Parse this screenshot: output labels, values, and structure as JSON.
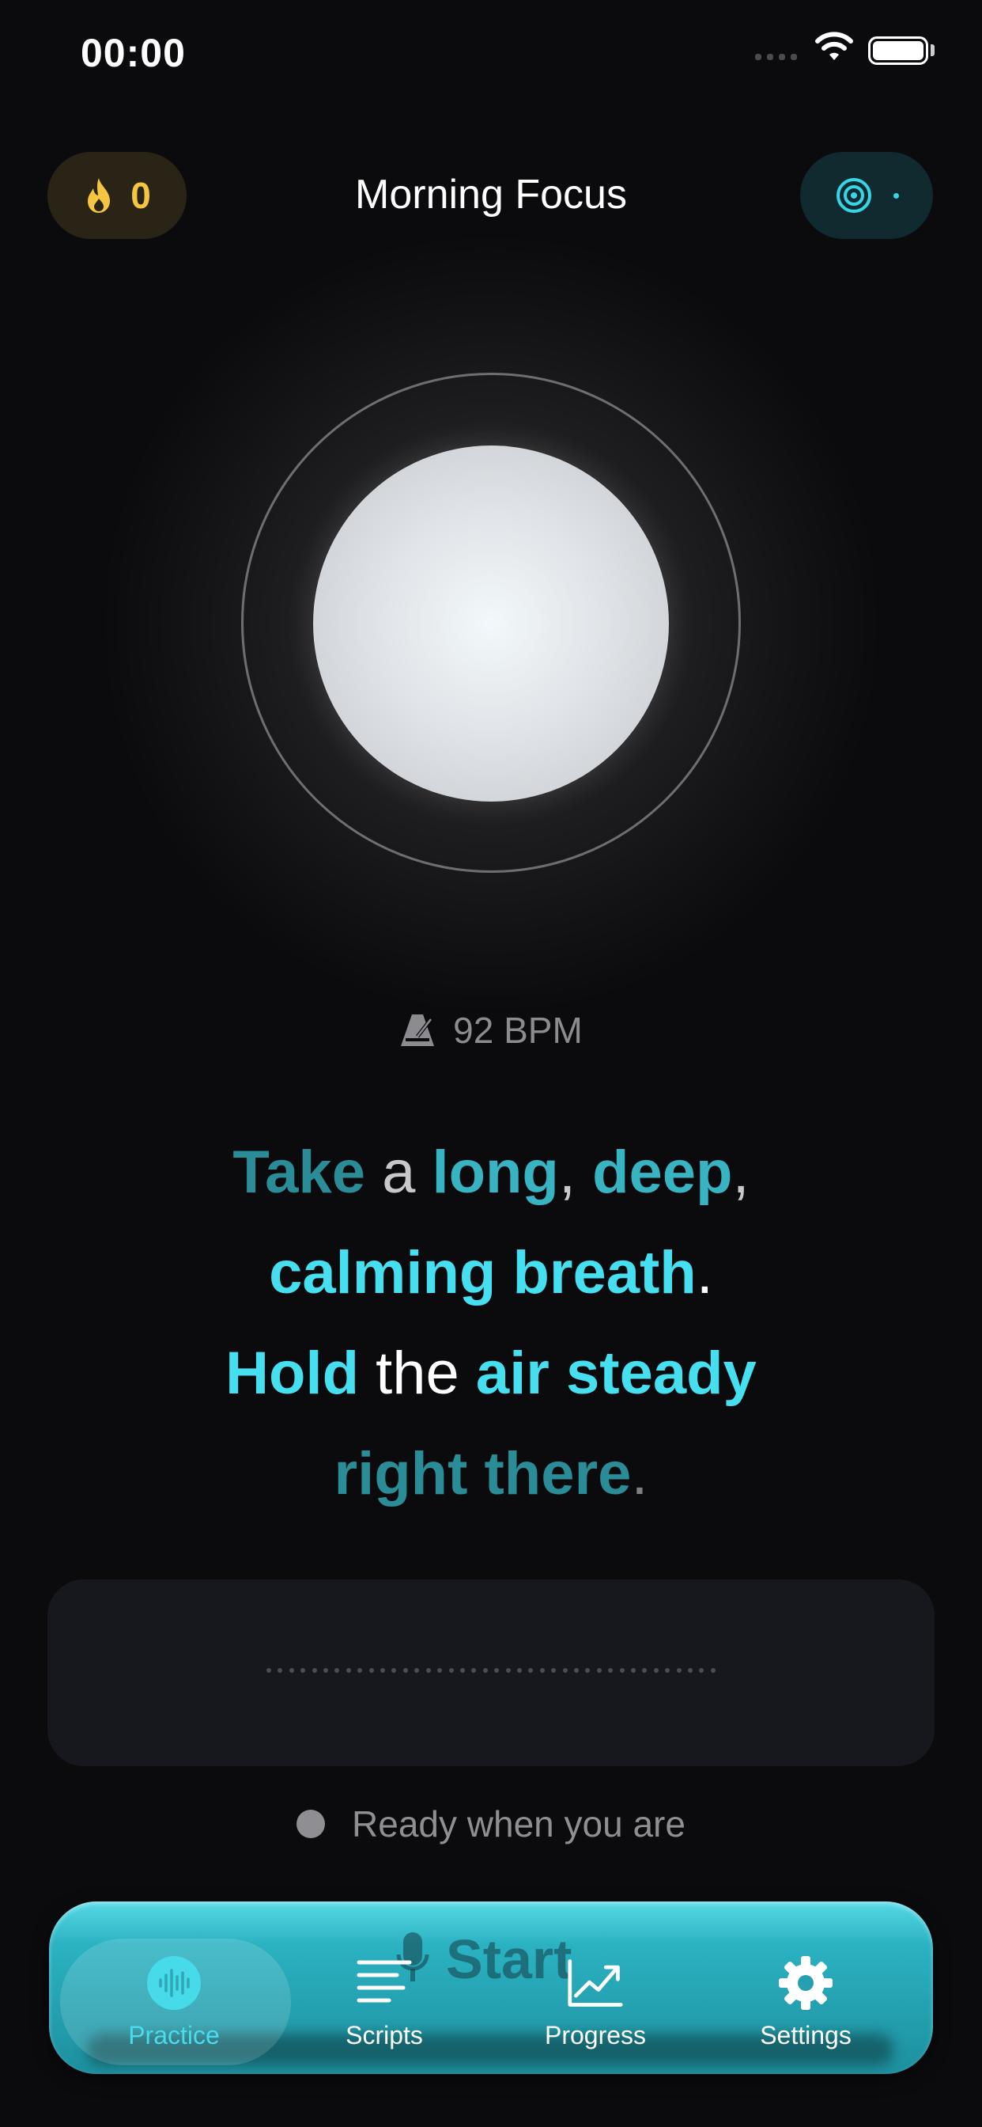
{
  "status_bar": {
    "time": "00:00"
  },
  "header": {
    "streak_count": "0",
    "title": "Morning Focus",
    "streak_icon": "flame-icon",
    "target_icon": "target-icon"
  },
  "tempo": {
    "label": "92 BPM",
    "icon": "metronome-icon"
  },
  "script": {
    "lines": [
      [
        "Take",
        " a ",
        "long",
        ",",
        " deep",
        ","
      ],
      [
        "calming breath",
        "."
      ],
      [
        "Hold",
        " the ",
        "air steady"
      ],
      [
        "right there",
        "."
      ]
    ]
  },
  "status": {
    "text": "Ready when you are"
  },
  "record_button": {
    "label": "Start",
    "icon": "microphone-icon"
  },
  "tabbar": {
    "tabs": [
      {
        "label": "Practice",
        "icon": "waveform-icon",
        "active": true
      },
      {
        "label": "Scripts",
        "icon": "lines-icon",
        "active": false
      },
      {
        "label": "Progress",
        "icon": "chart-icon",
        "active": false
      },
      {
        "label": "Settings",
        "icon": "gear-icon",
        "active": false
      }
    ]
  },
  "colors": {
    "accent": "#45dff0",
    "streak": "#f5c542",
    "background": "#0b0b0e"
  }
}
